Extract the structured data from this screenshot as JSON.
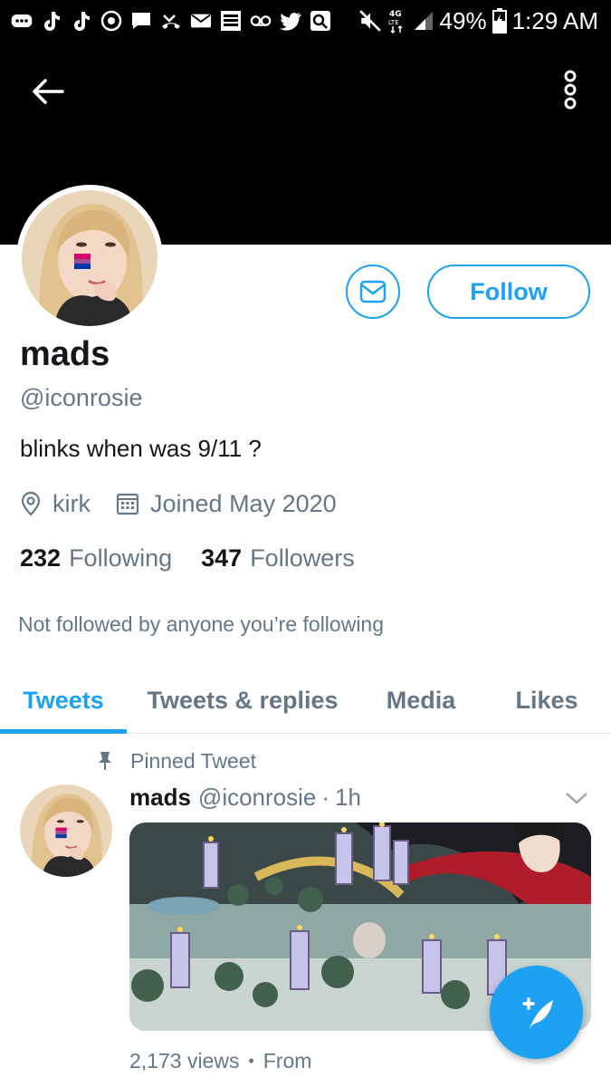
{
  "status_bar": {
    "battery": "49%",
    "time": "1:29 AM",
    "left_icons": [
      "chat-bubbles-icon",
      "tiktok-icon",
      "tiktok-icon",
      "clock-badge-icon",
      "message-icon",
      "missed-call-icon",
      "mail-icon",
      "app-badge-icon",
      "voicemail-icon",
      "twitter-icon",
      "photo-app-icon"
    ],
    "right_icons": [
      "mute-icon",
      "network-4g-lte-icon",
      "signal-icon",
      "battery-icon"
    ]
  },
  "profile": {
    "name": "mads",
    "handle": "@iconrosie",
    "bio": "blinks when was 9/11 ?",
    "location": "kirk",
    "joined": "Joined May 2020",
    "following_count": "232",
    "following_label": "Following",
    "followers_count": "347",
    "followers_label": "Followers",
    "follow_button": "Follow",
    "not_followed_note": "Not followed by anyone you’re following"
  },
  "tabs": [
    {
      "label": "Tweets",
      "active": true
    },
    {
      "label": "Tweets & replies",
      "active": false
    },
    {
      "label": "Media",
      "active": false
    },
    {
      "label": "Likes",
      "active": false
    }
  ],
  "tweet": {
    "pinned_label": "Pinned Tweet",
    "name": "mads",
    "handle": "@iconrosie",
    "dot": "·",
    "time": "1h",
    "views": "2,173 views",
    "bullet": "•",
    "from": "From"
  },
  "colors": {
    "accent": "#1da1f2",
    "muted": "#657786",
    "text": "#14171a",
    "header": "#000000"
  }
}
